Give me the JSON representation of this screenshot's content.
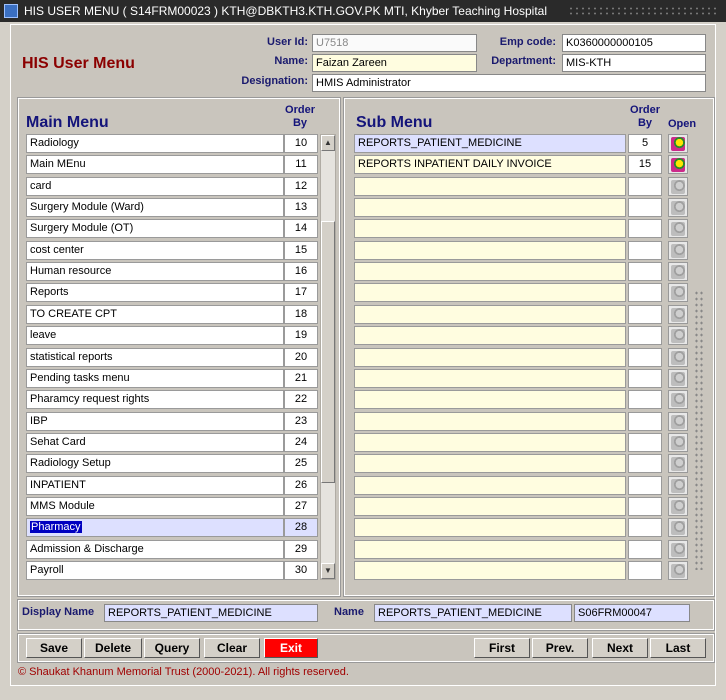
{
  "window": {
    "title": "HIS USER MENU ( S14FRM00023 )  KTH@DBKTH3.KTH.GOV.PK   MTI, Khyber Teaching Hospital"
  },
  "header": {
    "app_title": "HIS User Menu",
    "user_id_label": "User Id:",
    "user_id": "U7518",
    "name_label": "Name:",
    "name": "Faizan Zareen",
    "designation_label": "Designation:",
    "designation": "HMIS Administrator",
    "emp_code_label": "Emp code:",
    "emp_code": "K0360000000105",
    "department_label": "Department:",
    "department": "MIS-KTH"
  },
  "main_menu": {
    "title": "Main Menu",
    "order_label": "Order",
    "by_label": "By",
    "items": [
      {
        "label": "Radiology",
        "order": "10"
      },
      {
        "label": "Main MEnu",
        "order": "11"
      },
      {
        "label": "card",
        "order": "12"
      },
      {
        "label": "Surgery Module (Ward)",
        "order": "13"
      },
      {
        "label": "Surgery Module (OT)",
        "order": "14"
      },
      {
        "label": "cost center",
        "order": "15"
      },
      {
        "label": "Human resource",
        "order": "16"
      },
      {
        "label": "Reports",
        "order": "17"
      },
      {
        "label": "TO CREATE CPT",
        "order": "18"
      },
      {
        "label": "leave",
        "order": "19"
      },
      {
        "label": "statistical reports",
        "order": "20"
      },
      {
        "label": "Pending tasks menu",
        "order": "21"
      },
      {
        "label": "Pharamcy request rights",
        "order": "22"
      },
      {
        "label": "IBP",
        "order": "23"
      },
      {
        "label": "Sehat Card",
        "order": "24"
      },
      {
        "label": "Radiology Setup",
        "order": "25"
      },
      {
        "label": "INPATIENT",
        "order": "26"
      },
      {
        "label": "MMS Module",
        "order": "27"
      },
      {
        "label": "Pharmacy",
        "order": "28"
      },
      {
        "label": "Admission & Discharge",
        "order": "29"
      },
      {
        "label": "Payroll",
        "order": "30"
      }
    ],
    "selected_index": 18
  },
  "sub_menu": {
    "title": "Sub Menu",
    "order_label": "Order",
    "by_label": "By",
    "open_label": "Open",
    "items": [
      {
        "label": "REPORTS_PATIENT_MEDICINE",
        "order": "5"
      },
      {
        "label": "REPORTS INPATIENT DAILY INVOICE",
        "order": "15"
      }
    ],
    "total_rows": 21
  },
  "details": {
    "display_name_label": "Display Name",
    "display_name": "REPORTS_PATIENT_MEDICINE",
    "name_label": "Name",
    "name": "REPORTS_PATIENT_MEDICINE",
    "form_code": "S06FRM00047"
  },
  "buttons": {
    "save": "Save",
    "delete": "Delete",
    "query": "Query",
    "clear": "Clear",
    "exit": "Exit",
    "first": "First",
    "prev": "Prev.",
    "next": "Next",
    "last": "Last"
  },
  "footer": {
    "copyright": "© Shaukat Khanum Memorial Trust (2000-2021). All rights reserved."
  },
  "colors": {
    "title_red": "#8b0000",
    "label_blue": "#14147a",
    "exit_red": "#ff0000"
  }
}
